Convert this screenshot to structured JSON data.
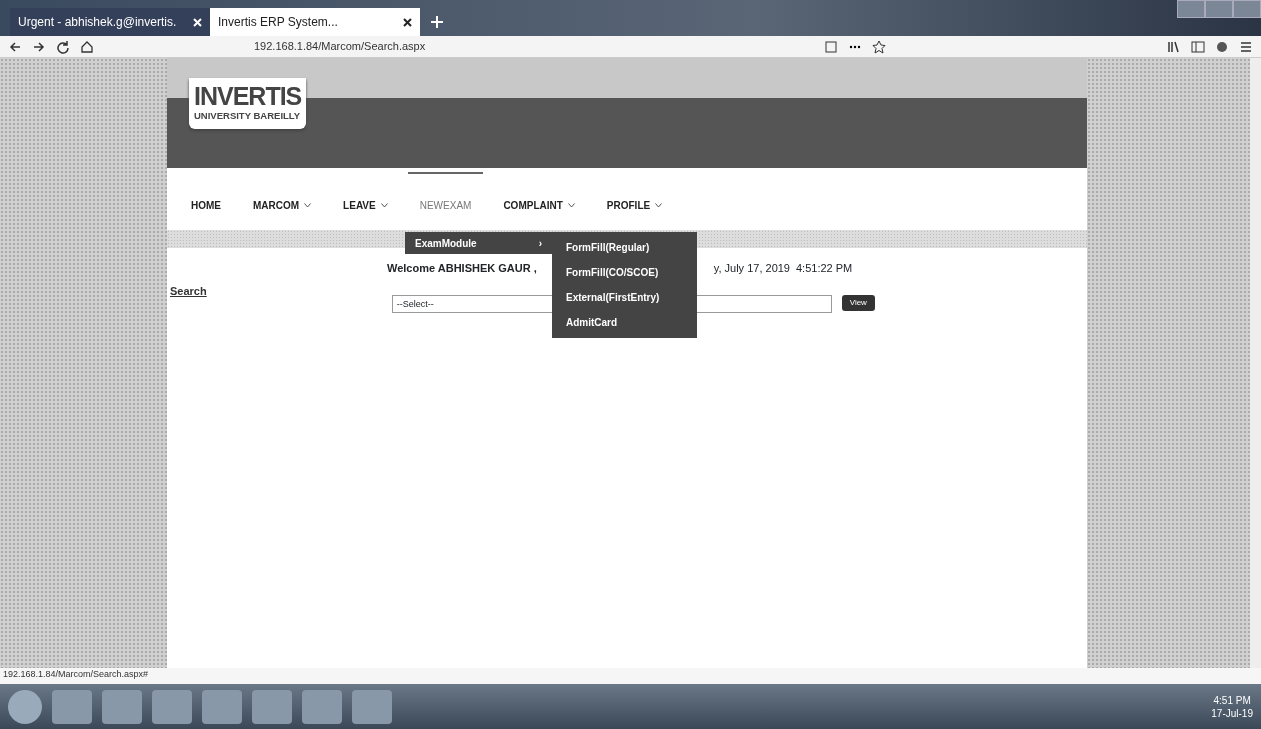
{
  "browser": {
    "tabs": [
      {
        "title": "Urgent - abhishek.g@invertis.",
        "selected": false
      },
      {
        "title": "Invertis ERP System...",
        "selected": true
      }
    ],
    "address": "192.168.1.84/Marcom/Search.aspx",
    "status_url": "192.168.1.84/Marcom/Search.aspx#"
  },
  "logo": {
    "name": "INVERTIS",
    "subtitle": "UNIVERSITY BAREILLY"
  },
  "nav": [
    {
      "label": "HOME",
      "dropdown": false,
      "selected": false
    },
    {
      "label": "MARCOM",
      "dropdown": true,
      "selected": false
    },
    {
      "label": "LEAVE",
      "dropdown": true,
      "selected": false
    },
    {
      "label": "NEWEXAM",
      "dropdown": false,
      "selected": true
    },
    {
      "label": "COMPLAINT",
      "dropdown": true,
      "selected": false
    },
    {
      "label": "PROFILE",
      "dropdown": true,
      "selected": false
    }
  ],
  "menu": {
    "label": "ExamModule",
    "arrow": "›",
    "submenu": [
      "FormFill(Regular)",
      "FormFill(CO/SCOE)",
      "External(FirstEntry)",
      "AdmitCard"
    ]
  },
  "welcome": {
    "text": "Welcome",
    "user": "ABHISHEK GAUR ,",
    "date_fragment": "y, July 17, 2019",
    "time": "4:51:22 PM"
  },
  "search": {
    "link": "Search",
    "select_value": "--Select--",
    "button": "View"
  },
  "taskbar": {
    "time": "4:51 PM",
    "date": "17-Jul-19"
  }
}
